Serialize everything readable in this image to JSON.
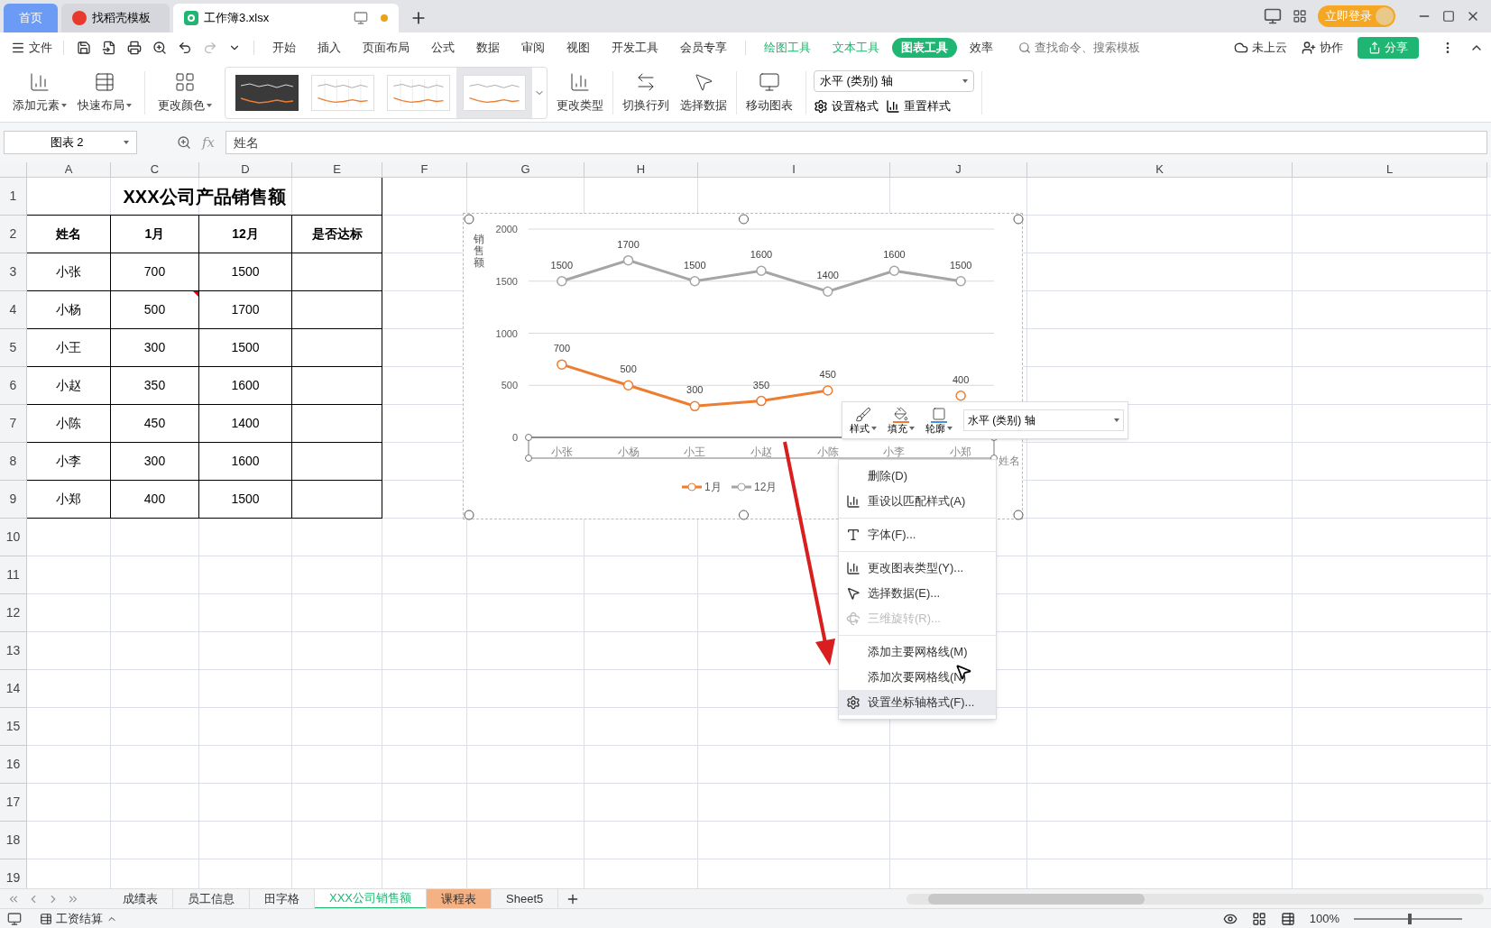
{
  "doc_tabs": [
    {
      "label": "首页",
      "kind": "home",
      "selected": false
    },
    {
      "label": "找稻壳模板",
      "kind": "docer",
      "selected": false
    },
    {
      "label": "工作簿3.xlsx",
      "kind": "sheet",
      "selected": true
    }
  ],
  "login_button": "立即登录",
  "file_menu": "文件",
  "menu_tabs": [
    {
      "label": "开始",
      "kind": "normal",
      "selected": false
    },
    {
      "label": "插入",
      "kind": "normal",
      "selected": false
    },
    {
      "label": "页面布局",
      "kind": "normal",
      "selected": false
    },
    {
      "label": "公式",
      "kind": "normal",
      "selected": false
    },
    {
      "label": "数据",
      "kind": "normal",
      "selected": false
    },
    {
      "label": "审阅",
      "kind": "normal",
      "selected": false
    },
    {
      "label": "视图",
      "kind": "normal",
      "selected": false
    },
    {
      "label": "开发工具",
      "kind": "normal",
      "selected": false
    },
    {
      "label": "会员专享",
      "kind": "normal",
      "selected": false
    },
    {
      "label": "绘图工具",
      "kind": "context",
      "selected": false
    },
    {
      "label": "文本工具",
      "kind": "context",
      "selected": false
    },
    {
      "label": "图表工具",
      "kind": "context",
      "selected": true
    },
    {
      "label": "效率",
      "kind": "normal",
      "selected": false
    }
  ],
  "search": {
    "placeholder": "查找命令、搜索模板"
  },
  "top_actions": [
    "未上云",
    "协作"
  ],
  "share_button": "分享",
  "ribbon_left": [
    "添加元素",
    "快速布局",
    "更改颜色"
  ],
  "chart_styles": [
    {
      "kind": "dark",
      "selected": false
    },
    {
      "kind": "grid",
      "selected": false
    },
    {
      "kind": "grid",
      "selected": false
    },
    {
      "kind": "plain",
      "selected": true
    }
  ],
  "ribbon_right": [
    "更改类型",
    "切换行列",
    "选择数据",
    "移动图表"
  ],
  "element_select": "水平 (类别) 轴",
  "format_buttons": [
    "设置格式",
    "重置样式"
  ],
  "name_box": "图表 2",
  "function_label": "fx",
  "formula": "姓名",
  "columns": [
    "A",
    "C",
    "D",
    "E",
    "F",
    "G",
    "H",
    "I",
    "J",
    "K",
    "L"
  ],
  "row_numbers": [
    "1",
    "2",
    "3",
    "4",
    "5",
    "6",
    "7",
    "8",
    "9",
    "10",
    "11",
    "12",
    "13",
    "14",
    "15",
    "16",
    "17",
    "18",
    "19"
  ],
  "table": {
    "title": "XXX公司产品销售额",
    "headers": [
      "姓名",
      "1月",
      "12月",
      "是否达标"
    ],
    "rows": [
      {
        "cells": [
          "小张",
          "700",
          "1500"
        ],
        "comment": false
      },
      {
        "cells": [
          "小杨",
          "500",
          "1700"
        ],
        "comment": true
      },
      {
        "cells": [
          "小王",
          "300",
          "1500"
        ],
        "comment": false
      },
      {
        "cells": [
          "小赵",
          "350",
          "1600"
        ],
        "comment": false
      },
      {
        "cells": [
          "小陈",
          "450",
          "1400"
        ],
        "comment": false
      },
      {
        "cells": [
          "小李",
          "300",
          "1600"
        ],
        "comment": false
      },
      {
        "cells": [
          "小郑",
          "400",
          "1500"
        ],
        "comment": false
      }
    ]
  },
  "chart": {
    "chart_data": {
      "type": "line",
      "xlabel": "姓名",
      "ylabel": "销售额",
      "categories": [
        "小张",
        "小杨",
        "小王",
        "小赵",
        "小陈",
        "小李",
        "小郑"
      ],
      "series": [
        {
          "name": "1月",
          "color": "#ed7d31",
          "marker": "circle",
          "values": [
            700,
            500,
            300,
            350,
            450,
            null,
            400
          ]
        },
        {
          "name": "12月",
          "color": "#a5a5a5",
          "marker": "circle",
          "values": [
            1500,
            1700,
            1500,
            1600,
            1400,
            1600,
            1500
          ]
        }
      ],
      "ylim": [
        0,
        2000
      ],
      "yticks": [
        0,
        500,
        1000,
        1500,
        2000
      ],
      "grid": true,
      "legend": true,
      "data_labels": true
    }
  },
  "mini_toolbar": {
    "buttons": [
      "样式",
      "填充",
      "轮廓"
    ],
    "select": "水平 (类别) 轴"
  },
  "context_menu": [
    [
      {
        "label": "删除(D)",
        "disabled": false,
        "selected": false
      },
      {
        "label": "重设以匹配样式(A)",
        "disabled": false,
        "selected": false
      }
    ],
    [
      {
        "label": "字体(F)...",
        "disabled": false,
        "selected": false
      }
    ],
    [
      {
        "label": "更改图表类型(Y)...",
        "disabled": false,
        "selected": false
      },
      {
        "label": "选择数据(E)...",
        "disabled": false,
        "selected": false
      },
      {
        "label": "三维旋转(R)...",
        "disabled": true,
        "selected": false
      }
    ],
    [
      {
        "label": "添加主要网格线(M)",
        "disabled": false,
        "selected": false
      },
      {
        "label": "添加次要网格线(N)",
        "disabled": false,
        "selected": false
      },
      {
        "label": "设置坐标轴格式(F)...",
        "disabled": false,
        "selected": true
      }
    ]
  ],
  "sheet_tabs": [
    {
      "label": "成绩表",
      "selected": false
    },
    {
      "label": "员工信息",
      "selected": false
    },
    {
      "label": "田字格",
      "selected": false
    },
    {
      "label": "XXX公司销售额",
      "selected": true
    },
    {
      "label": "课程表",
      "selected": false,
      "color": "#f4b183"
    },
    {
      "label": "Sheet5",
      "selected": false
    }
  ],
  "status_bar": {
    "macro": "工资结算",
    "zoom": "100%",
    "zoom_slider": {
      "level": 0.5
    }
  }
}
